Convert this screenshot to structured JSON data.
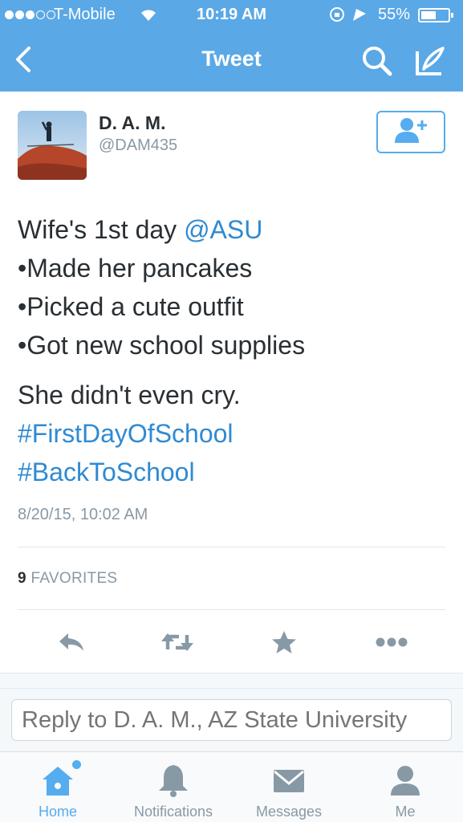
{
  "status": {
    "carrier": "T-Mobile",
    "time": "10:19 AM",
    "battery": "55%",
    "battery_level": 0.55,
    "signal_bars_filled": 3,
    "signal_bars_total": 5
  },
  "nav": {
    "title": "Tweet",
    "back_icon": "chevron-left-icon",
    "search_icon": "search-icon",
    "compose_icon": "compose-icon"
  },
  "tweet": {
    "author_name": "D. A. M.",
    "author_handle": "@DAM435",
    "line1_prefix": "Wife's 1st day ",
    "line1_mention": "@ASU",
    "bullets": [
      "•Made her pancakes",
      "•Picked a cute outfit",
      "•Got new school supplies"
    ],
    "line_after": "She didn't even cry.",
    "hashtags": [
      "#FirstDayOfSchool",
      "#BackToSchool"
    ],
    "timestamp": "8/20/15, 10:02 AM",
    "favorites_count": "9",
    "favorites_label": "FAVORITES"
  },
  "reply": {
    "placeholder": "Reply to D. A. M., AZ State University"
  },
  "tabs": [
    {
      "label": "Home",
      "icon": "home-icon",
      "active": true
    },
    {
      "label": "Notifications",
      "icon": "bell-icon",
      "active": false
    },
    {
      "label": "Messages",
      "icon": "envelope-icon",
      "active": false
    },
    {
      "label": "Me",
      "icon": "person-icon",
      "active": false
    }
  ],
  "colors": {
    "brand": "#55acee",
    "header_bg": "#5aa8e6",
    "link": "#2f8ad2",
    "muted": "#8899a6",
    "icon_gray": "#8899a6"
  }
}
